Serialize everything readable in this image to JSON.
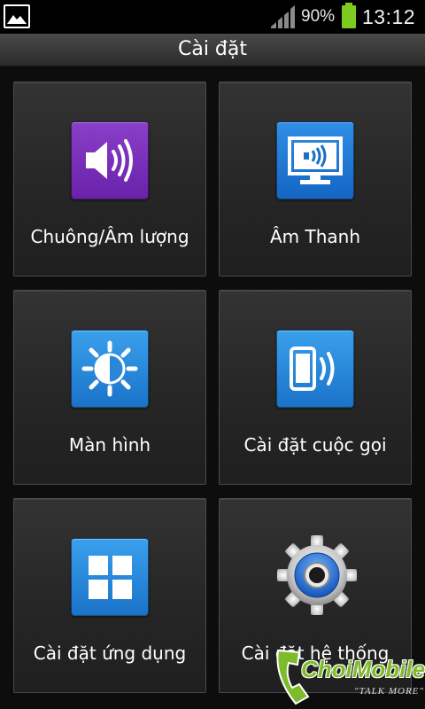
{
  "status_bar": {
    "battery_percent": "90%",
    "time": "13:12"
  },
  "header": {
    "title": "Cài đặt"
  },
  "tiles": [
    {
      "label": "Chuông/Âm lượng",
      "icon": "speaker-volume-icon"
    },
    {
      "label": "Âm Thanh",
      "icon": "monitor-sound-icon"
    },
    {
      "label": "Màn hình",
      "icon": "brightness-icon"
    },
    {
      "label": "Cài đặt cuộc gọi",
      "icon": "phone-call-icon"
    },
    {
      "label": "Cài đặt ứng dụng",
      "icon": "apps-grid-icon"
    },
    {
      "label": "Cài đặt hệ thống",
      "icon": "gear-icon"
    }
  ],
  "watermark": {
    "brand": "ChoiMobile",
    "tagline": "\"TALK MORE\""
  },
  "colors": {
    "purple_tile": "#7a30bb",
    "blue_tile": "#2a88dc",
    "battery": "#7ecb20"
  }
}
